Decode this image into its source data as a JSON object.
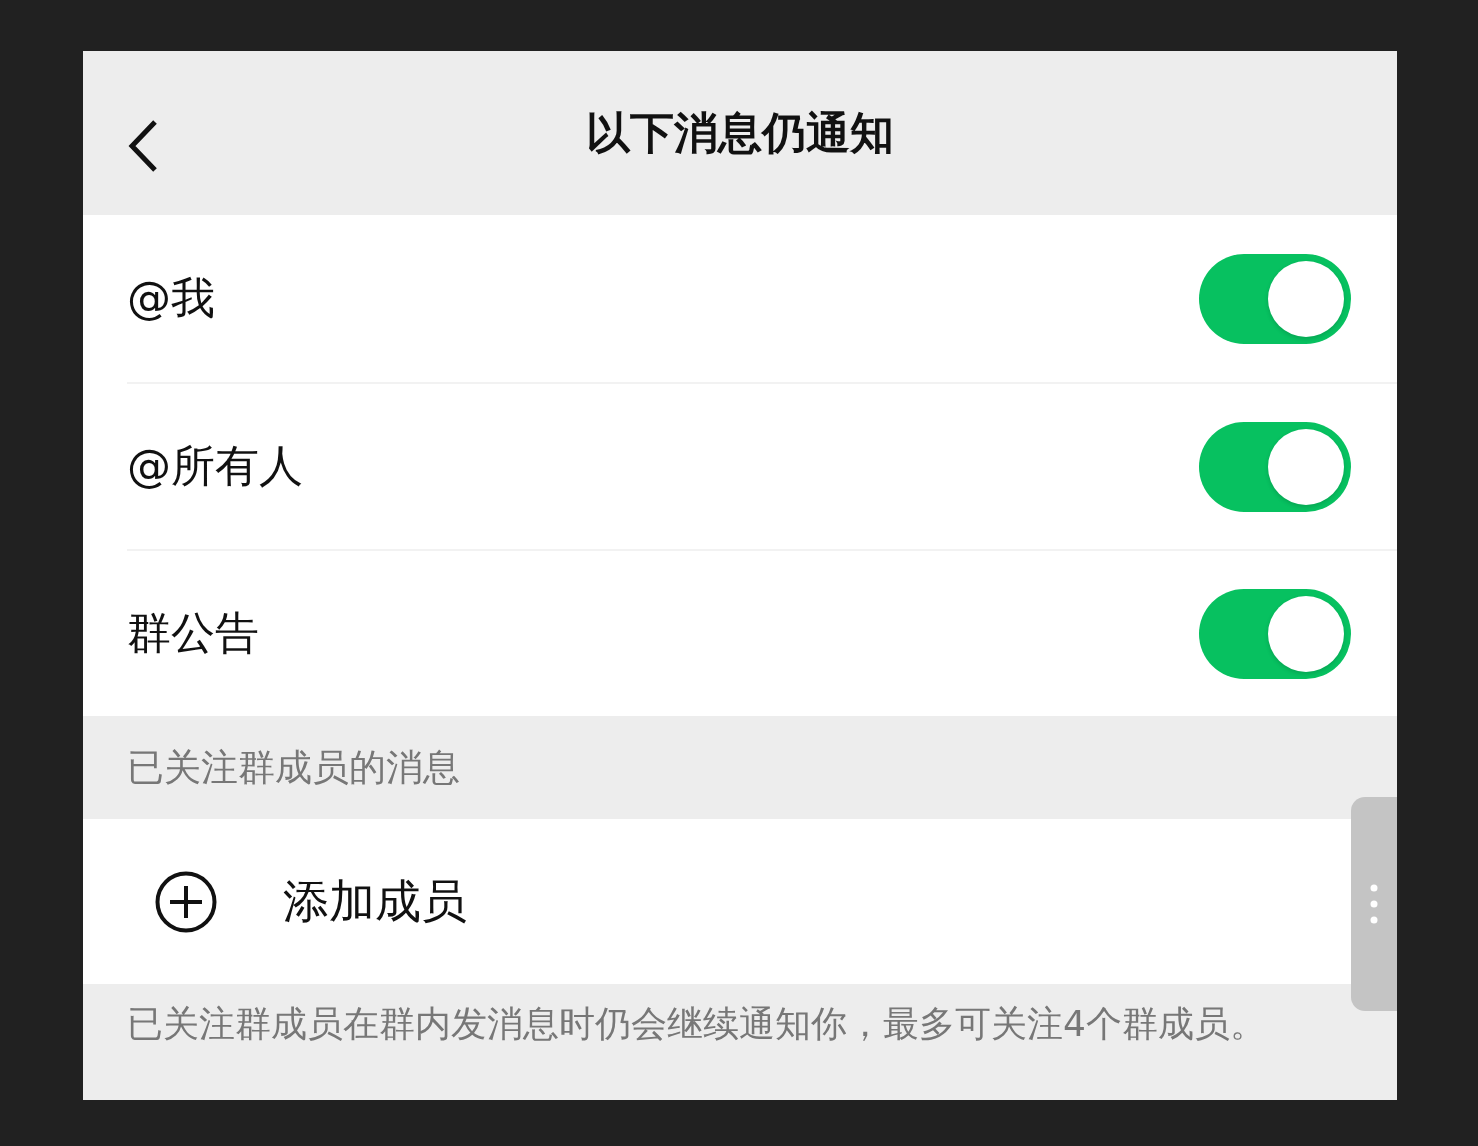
{
  "header": {
    "title": "以下消息仍通知"
  },
  "toggles": [
    {
      "label": "@我",
      "on": true
    },
    {
      "label": "@所有人",
      "on": true
    },
    {
      "label": "群公告",
      "on": true
    }
  ],
  "followed_section": {
    "title": "已关注群成员的消息",
    "add_label": "添加成员",
    "footnote": "已关注群成员在群内发消息时仍会继续通知你，最多可关注4个群成员。"
  }
}
